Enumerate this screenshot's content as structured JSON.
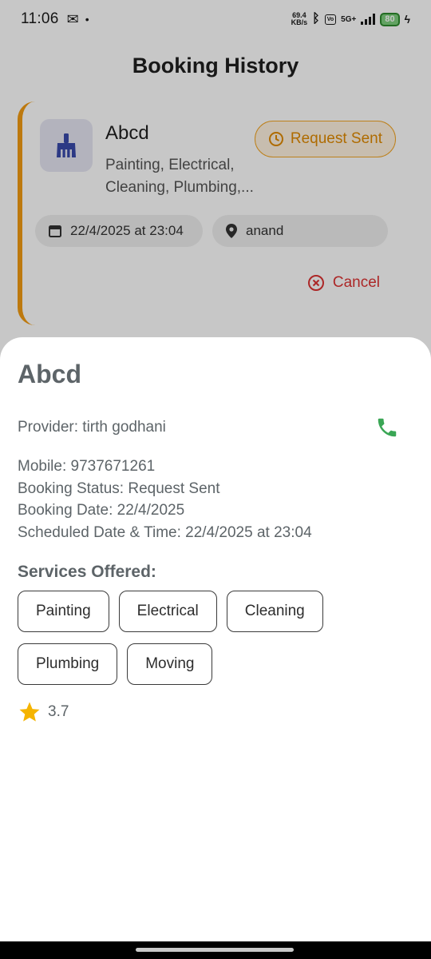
{
  "status_bar": {
    "time": "11:06",
    "net_speed_value": "69.4",
    "net_speed_unit": "KB/s",
    "network_type": "5G+",
    "battery": "80"
  },
  "app_bar": {
    "title": "Booking History"
  },
  "booking_card": {
    "title": "Abcd",
    "services": "Painting, Electrical, Cleaning, Plumbing,...",
    "status": "Request Sent",
    "date": "22/4/2025 at 23:04",
    "location": "anand",
    "cancel_label": "Cancel",
    "accent_color": "#f29c12"
  },
  "sheet": {
    "title": "Abcd",
    "provider": "Provider: tirth godhani",
    "mobile": "Mobile: 9737671261",
    "booking_status": "Booking Status: Request Sent",
    "booking_date": "Booking Date: 22/4/2025",
    "scheduled": "Scheduled Date & Time: 22/4/2025 at 23:04",
    "services_heading": "Services Offered:",
    "services": [
      "Painting",
      "Electrical",
      "Cleaning",
      "Plumbing",
      "Moving"
    ],
    "rating": "3.7",
    "phone_icon": "phone-icon",
    "phone_color": "#3aa655",
    "star_color": "#f5b400"
  }
}
